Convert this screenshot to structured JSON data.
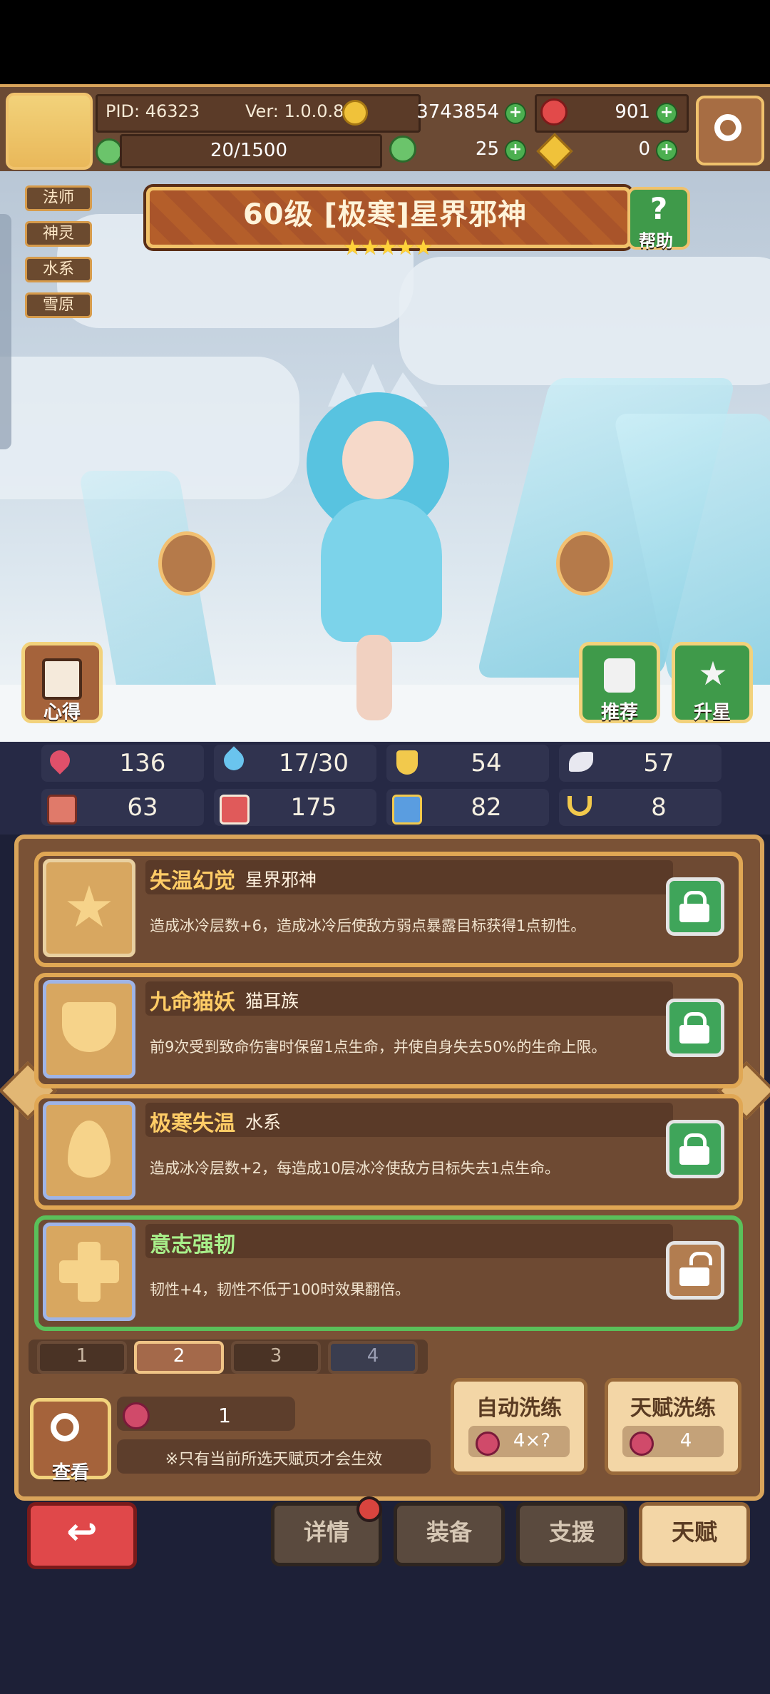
{
  "header": {
    "pid": "PID: 46323",
    "version": "Ver: 1.0.0.8",
    "gold": "3743854",
    "gems": "901",
    "stamina": "20/1500",
    "clover": "25",
    "keys": "0",
    "plus": "+",
    "settings_icon": "gear-icon"
  },
  "hero": {
    "tags": [
      "法师",
      "神灵",
      "水系",
      "雪原"
    ],
    "title": "60级 [极寒]星界邪神",
    "stars": 5,
    "star_glyph": "★★★★★",
    "help_label": "帮助",
    "buttons": {
      "insight": "心得",
      "recommend": "推荐",
      "upgrade": "升星"
    }
  },
  "stats": [
    {
      "icon": "heart-icon",
      "value": "136",
      "color": "#e0506a"
    },
    {
      "icon": "water-drop-icon",
      "value": "17/30",
      "color": "#6ac4ee"
    },
    {
      "icon": "shield-icon",
      "value": "54",
      "color": "#f2c94c"
    },
    {
      "icon": "wing-icon",
      "value": "57",
      "color": "#e8e8f0"
    },
    {
      "icon": "fist-icon",
      "value": "63",
      "color": "#e07a6a"
    },
    {
      "icon": "book-icon",
      "value": "175",
      "color": "#e05a5a"
    },
    {
      "icon": "boot-icon",
      "value": "82",
      "color": "#5a9de0"
    },
    {
      "icon": "horseshoe-icon",
      "value": "8",
      "color": "#f2c94c"
    }
  ],
  "talents": [
    {
      "name": "失温幻觉",
      "type": "星界邪神",
      "desc": "造成冰冷层数+6，造成冰冷后使敌方弱点暴露目标获得1点韧性。",
      "locked": true,
      "selected": false
    },
    {
      "name": "九命猫妖",
      "type": "猫耳族",
      "desc": "前9次受到致命伤害时保留1点生命，并使自身失去50%的生命上限。",
      "locked": true,
      "selected": false
    },
    {
      "name": "极寒失温",
      "type": "水系",
      "desc": "造成冰冷层数+2，每造成10层冰冷使敌方目标失去1点生命。",
      "locked": true,
      "selected": false
    },
    {
      "name": "意志强韧",
      "type": "",
      "desc": "韧性+4，韧性不低于100时效果翻倍。",
      "locked": false,
      "selected": true
    }
  ],
  "pages": [
    "1",
    "2",
    "3",
    "4"
  ],
  "active_page": "2",
  "footer": {
    "view_label": "查看",
    "fruit_count": "1",
    "note": "※只有当前所选天赋页才会生效",
    "auto_train": {
      "title": "自动洗练",
      "cost": "4×?"
    },
    "talent_train": {
      "title": "天赋洗练",
      "cost": "4"
    }
  },
  "nav": {
    "back_icon": "back-arrow-icon",
    "tabs": [
      "详情",
      "装备",
      "支援",
      "天赋"
    ],
    "active": "天赋"
  }
}
